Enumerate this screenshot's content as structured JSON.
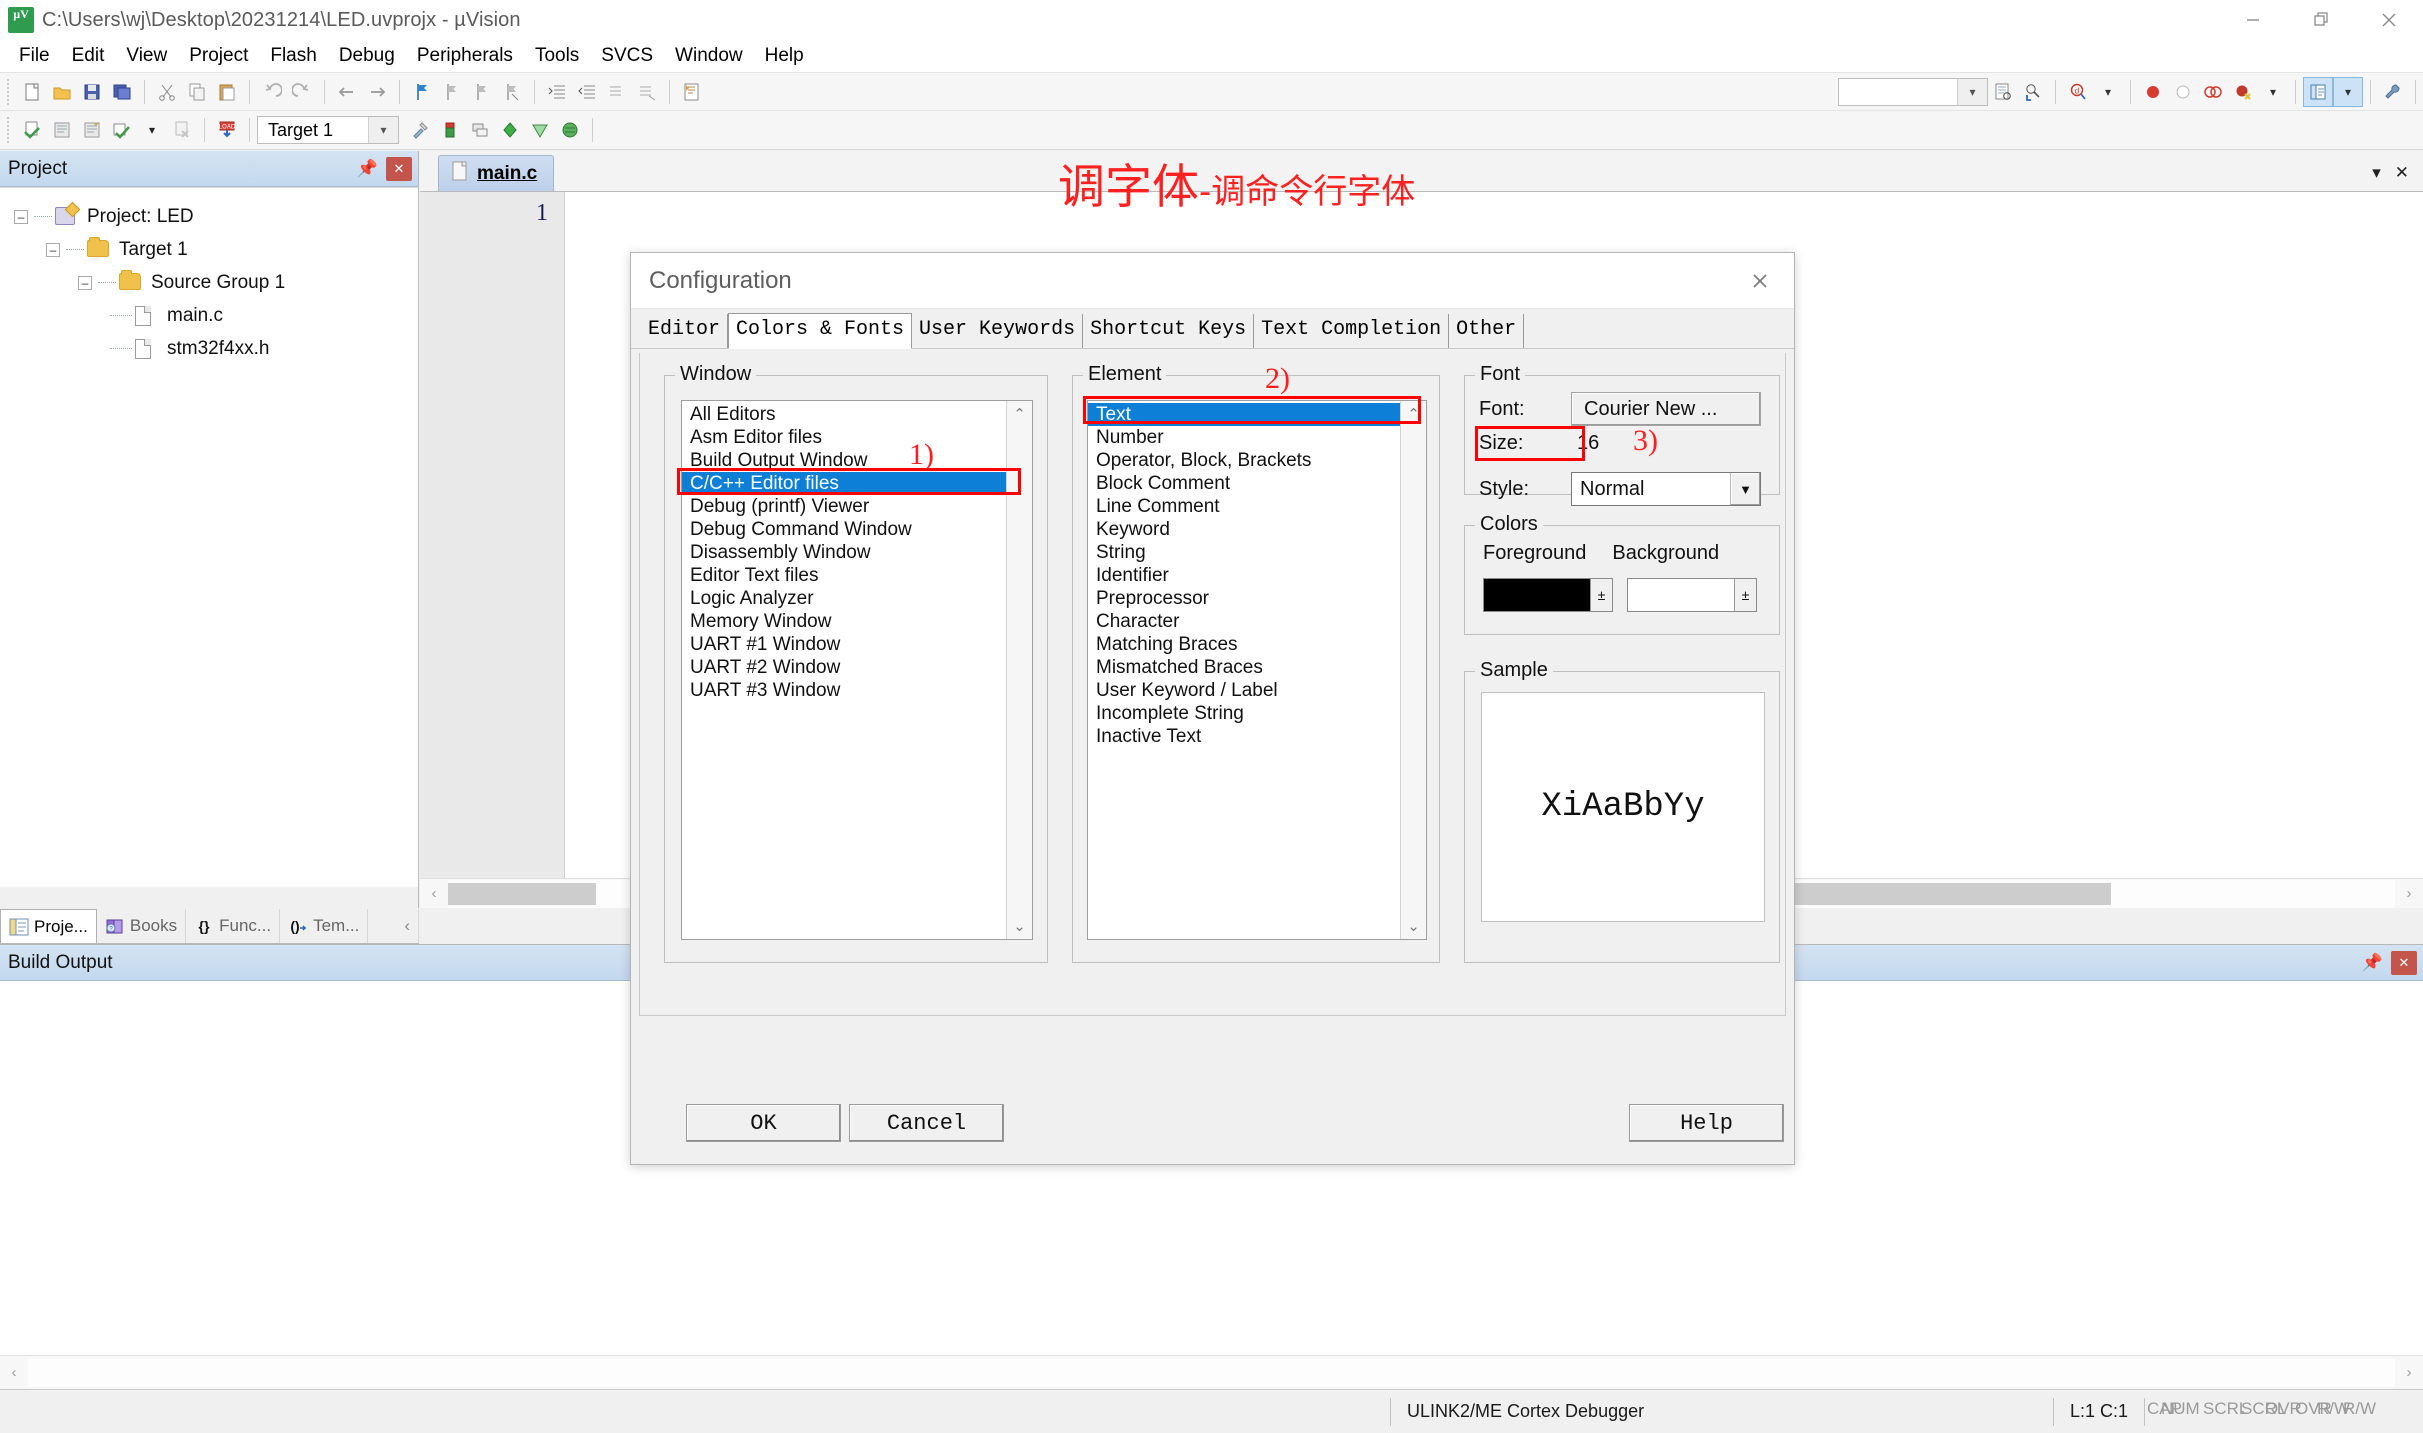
{
  "window": {
    "title": "C:\\Users\\wj\\Desktop\\20231214\\LED.uvprojx - µVision",
    "app_icon": "uvision-icon",
    "controls": {
      "minimize": "—",
      "restore": "❐",
      "close": "✕"
    }
  },
  "menubar": {
    "items": [
      "File",
      "Edit",
      "View",
      "Project",
      "Flash",
      "Debug",
      "Peripherals",
      "Tools",
      "SVCS",
      "Window",
      "Help"
    ]
  },
  "toolbar_row2": {
    "target_value": "Target 1"
  },
  "project_panel": {
    "title": "Project",
    "tree": [
      {
        "label": "Project: LED",
        "icon": "project-icon",
        "depth": 0,
        "expander": "-"
      },
      {
        "label": "Target 1",
        "icon": "target-folder-icon",
        "depth": 1,
        "expander": "-"
      },
      {
        "label": "Source Group 1",
        "icon": "folder-icon",
        "depth": 2,
        "expander": "-"
      },
      {
        "label": "main.c",
        "icon": "c-file-icon",
        "depth": 3,
        "expander": ""
      },
      {
        "label": "stm32f4xx.h",
        "icon": "h-file-icon",
        "depth": 3,
        "expander": ""
      }
    ],
    "tabs": [
      {
        "label": "Proje...",
        "icon": "project-tab-icon",
        "active": true
      },
      {
        "label": "Books",
        "icon": "books-icon",
        "active": false
      },
      {
        "label": "Func...",
        "icon": "functions-icon",
        "active": false
      },
      {
        "label": "Tem...",
        "icon": "templates-icon",
        "active": false
      }
    ]
  },
  "editor": {
    "tab_label": "main.c",
    "line_number": "1"
  },
  "build_output": {
    "title": "Build Output"
  },
  "statusbar": {
    "debugger": "ULINK2/ME Cortex Debugger",
    "position": "L:1 C:1",
    "indicators": [
      "CAP",
      "NUM",
      "SCRL",
      "OVR",
      "R/W"
    ]
  },
  "annotation": {
    "big": "调字体",
    "small": "-调命令行字体",
    "color": "#ff2020"
  },
  "dialog": {
    "title": "Configuration",
    "close_label": "✕",
    "tabs": [
      {
        "label": "Editor",
        "active": false
      },
      {
        "label": "Colors & Fonts",
        "active": true
      },
      {
        "label": "User Keywords",
        "active": false
      },
      {
        "label": "Shortcut Keys",
        "active": false
      },
      {
        "label": "Text Completion",
        "active": false
      },
      {
        "label": "Other",
        "active": false
      }
    ],
    "window_group": {
      "label": "Window",
      "items": [
        "All Editors",
        "Asm Editor files",
        "Build Output Window",
        "C/C++ Editor files",
        "Debug (printf) Viewer",
        "Debug Command Window",
        "Disassembly Window",
        "Editor Text files",
        "Logic Analyzer",
        "Memory Window",
        "UART #1 Window",
        "UART #2 Window",
        "UART #3 Window"
      ],
      "selected": "C/C++ Editor files",
      "callout": "1)"
    },
    "element_group": {
      "label": "Element",
      "items": [
        "Text",
        "Number",
        "Operator, Block, Brackets",
        "Block Comment",
        "Line Comment",
        "Keyword",
        "String",
        "Identifier",
        "Preprocessor",
        "Character",
        "Matching Braces",
        "Mismatched Braces",
        "User Keyword / Label",
        "Incomplete String",
        "Inactive Text"
      ],
      "selected": "Text",
      "callout": "2)"
    },
    "font_group": {
      "label": "Font",
      "font_label": "Font:",
      "font_value": "Courier New ...",
      "size_label": "Size:",
      "size_value": "16",
      "style_label": "Style:",
      "style_value": "Normal",
      "callout": "3)"
    },
    "colors_group": {
      "label": "Colors",
      "foreground_label": "Foreground",
      "background_label": "Background",
      "foreground_color": "#000000",
      "background_color": "#ffffff",
      "spinner_glyph": "±"
    },
    "sample_group": {
      "label": "Sample",
      "text": "XiAaBbYy"
    },
    "buttons": {
      "ok": "OK",
      "cancel": "Cancel",
      "help": "Help"
    }
  }
}
